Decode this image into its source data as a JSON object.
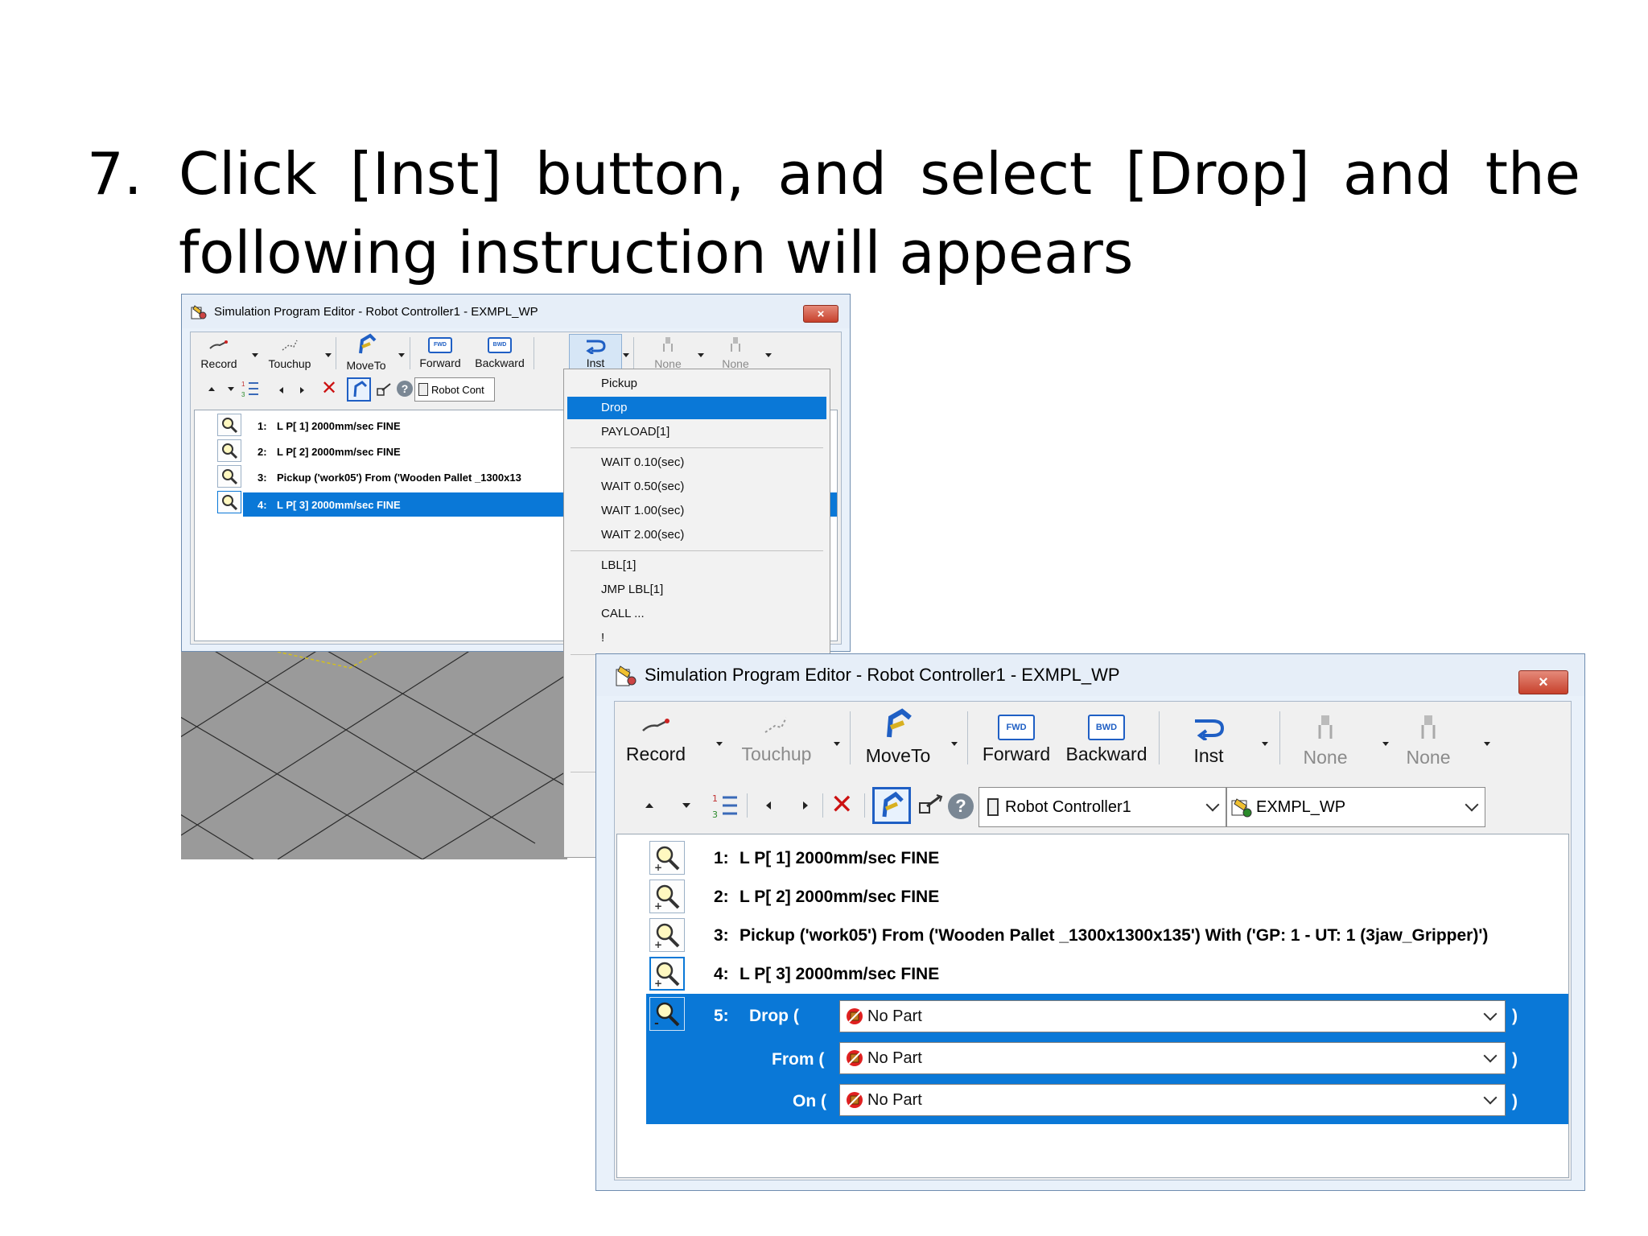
{
  "slide": {
    "number": "7.",
    "line1_words": [
      "Click",
      "[Inst]",
      "button,",
      "and",
      "select",
      "[Drop]",
      "and",
      "the"
    ],
    "line2": "following instruction will appears"
  },
  "window_back": {
    "title": "Simulation Program Editor - Robot Controller1 - EXMPL_WP",
    "close_label": "×",
    "toolbar": {
      "record": "Record",
      "touchup": "Touchup",
      "moveto": "MoveTo",
      "forward": "Forward",
      "backward": "Backward",
      "inst": "Inst",
      "none1": "None",
      "none2": "None",
      "fwd_icon": "FWD",
      "bwd_icon": "BWD"
    },
    "controller_combo": "Robot Cont",
    "lines": [
      {
        "num": "1:",
        "text": "L P[ 1] 2000mm/sec FINE"
      },
      {
        "num": "2:",
        "text": "L P[ 2] 2000mm/sec FINE"
      },
      {
        "num": "3:",
        "text": "Pickup ('work05') From ('Wooden Pallet _1300x13"
      },
      {
        "num": "4:",
        "text": "L P[ 3] 2000mm/sec FINE"
      }
    ],
    "selected_line": 3
  },
  "inst_menu": {
    "groups": [
      [
        "Pickup",
        "Drop",
        "PAYLOAD[1]"
      ],
      [
        "WAIT 0.10(sec)",
        "WAIT 0.50(sec)",
        "WAIT 1.00(sec)",
        "WAIT 2.00(sec)"
      ],
      [
        "LBL[1]",
        "JMP LBL[1]",
        "CALL ...",
        "!"
      ]
    ],
    "highlighted": "Drop"
  },
  "window_front": {
    "title": "Simulation Program Editor - Robot Controller1 - EXMPL_WP",
    "close_label": "×",
    "toolbar": {
      "record": "Record",
      "touchup": "Touchup",
      "moveto": "MoveTo",
      "forward": "Forward",
      "backward": "Backward",
      "inst": "Inst",
      "none1": "None",
      "none2": "None",
      "fwd_icon": "FWD",
      "bwd_icon": "BWD"
    },
    "controller_combo": "Robot Controller1",
    "program_combo": "EXMPL_WP",
    "lines": [
      {
        "num": "1:",
        "text": "L P[ 1] 2000mm/sec FINE"
      },
      {
        "num": "2:",
        "text": "L P[ 2] 2000mm/sec FINE"
      },
      {
        "num": "3:",
        "text": "Pickup ('work05') From ('Wooden Pallet _1300x1300x135') With ('GP: 1 - UT: 1  (3jaw_Gripper)')"
      },
      {
        "num": "4:",
        "text": "L P[ 3] 2000mm/sec FINE"
      }
    ],
    "drop": {
      "num": "5:",
      "drop_label": "Drop (",
      "from_label": "From (",
      "on_label": "On (",
      "close_paren": ")",
      "drop_value": "No Part",
      "from_value": "No Part",
      "on_value": "No Part"
    }
  },
  "colors": {
    "selection": "#0a78d7",
    "close_button": "#c7412c",
    "inst_arrow": "#1f5fc4"
  }
}
